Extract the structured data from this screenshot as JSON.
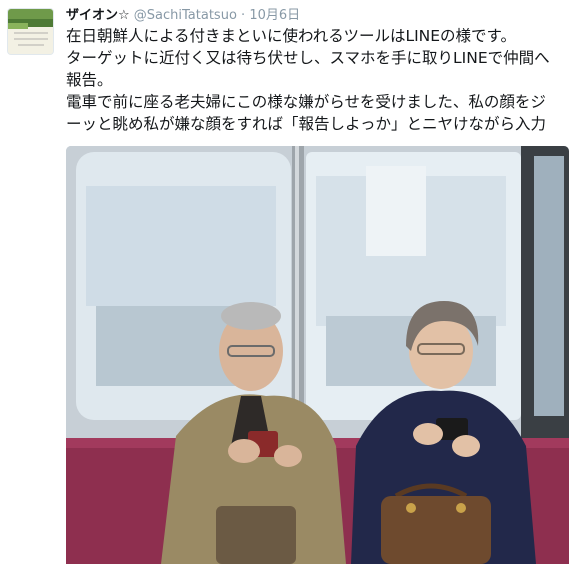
{
  "tweet": {
    "author": {
      "display_name": "ザイオン☆",
      "handle": "@SachiTatatsuo",
      "separator": "·",
      "date": "10月6日",
      "avatar_caption": "絶妙なのはいつも我が家の庭風景"
    },
    "text_lines": [
      "在日朝鮮人による付きまといに使われるツールはLINEの様です。",
      "ターゲットに近付く又は待ち伏せし、スマホを手に取りLINEで仲間へ",
      "報告。",
      "電車で前に座る老夫婦にこの様な嫌がらせを受けました、私の顔をジ",
      "ーッと眺め私が嫌な顔をすれば「報告しよっか」とニヤけながら入力"
    ],
    "media": {
      "alt": "train-photo"
    }
  },
  "colors": {
    "name": "#14171a",
    "secondary": "#8899a6",
    "seat": "#8e2f4f"
  }
}
